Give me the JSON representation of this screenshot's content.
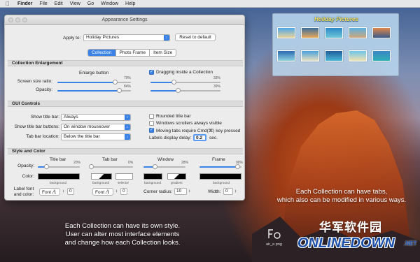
{
  "menubar": {
    "items": [
      "Finder",
      "File",
      "Edit",
      "View",
      "Go",
      "Window",
      "Help"
    ]
  },
  "window": {
    "title": "Appearance Settings",
    "apply_to_label": "Apply to:",
    "apply_to_value": "Holiday Pictures",
    "reset_button": "Reset to default",
    "tabs": [
      "Collection",
      "Photo Frame",
      "Item Size"
    ],
    "active_tab": "Collection",
    "collection_enlargement": {
      "header": "Collection Enlargement",
      "enlarge_button_label": "Enlarge button",
      "screen_size_ratio_label": "Screen size ratio:",
      "screen_size_ratio_value": "79%",
      "opacity_label": "Opacity:",
      "opacity_value": "84%",
      "dragging_label": "Dragging inside a Collection",
      "dragging_checked": true,
      "drag_slider1_value": "33%",
      "drag_slider2_value": "39%"
    },
    "gui_controls": {
      "header": "GUI Controls",
      "show_title_bar_label": "Show title bar:",
      "show_title_bar_value": "Always",
      "show_title_bar_buttons_label": "Show title bar buttons:",
      "show_title_bar_buttons_value": "On window mouseover",
      "tab_bar_location_label": "Tab bar location:",
      "tab_bar_location_value": "Below the title bar",
      "rounded_title_bar": "Rounded title bar",
      "rounded_checked": false,
      "scrollers_visible": "Windows scrollers always visible",
      "scrollers_checked": false,
      "moving_tabs": "Moving tabs require Cmd(⌘) key pressed",
      "moving_checked": true,
      "labels_delay_label": "Labels display delay:",
      "labels_delay_value": "0.2",
      "labels_delay_unit": "sec."
    },
    "style_and_color": {
      "header": "Style and Color",
      "col_title_bar": "Title bar",
      "col_tab_bar": "Tab bar",
      "col_window": "Window",
      "col_frame": "Frame",
      "opacity_label": "Opacity:",
      "title_bar_opacity": "20%",
      "tab_bar_opacity": "0%",
      "window_opacity": "28%",
      "frame_opacity": "90%",
      "color_label": "Color:",
      "background": "background",
      "selector": "selector",
      "gradient": "gradient",
      "label_font_label": "Label font\nand color:",
      "font_button": "Font",
      "font_glyph": "A",
      "corner_radius_label": "Corner radius:",
      "corner_radius_value": "10",
      "width_label": "Width:",
      "width_value": "0"
    }
  },
  "widget": {
    "title": "Holiday Pictures"
  },
  "captions": {
    "right": "Each Collection can have tabs,\nwhich also can be modified in various ways.",
    "left": "Each Collection can have its own style.\nUser can alter most interface elements\nand change how each Collection looks."
  },
  "logo": {
    "developer_text": "air_e.png"
  },
  "watermark": {
    "cn_text": "华军软件园",
    "site_text": "ONLINEDOWN",
    ".net": ".NET"
  },
  "colors": {
    "accent": "#3a82e6"
  }
}
